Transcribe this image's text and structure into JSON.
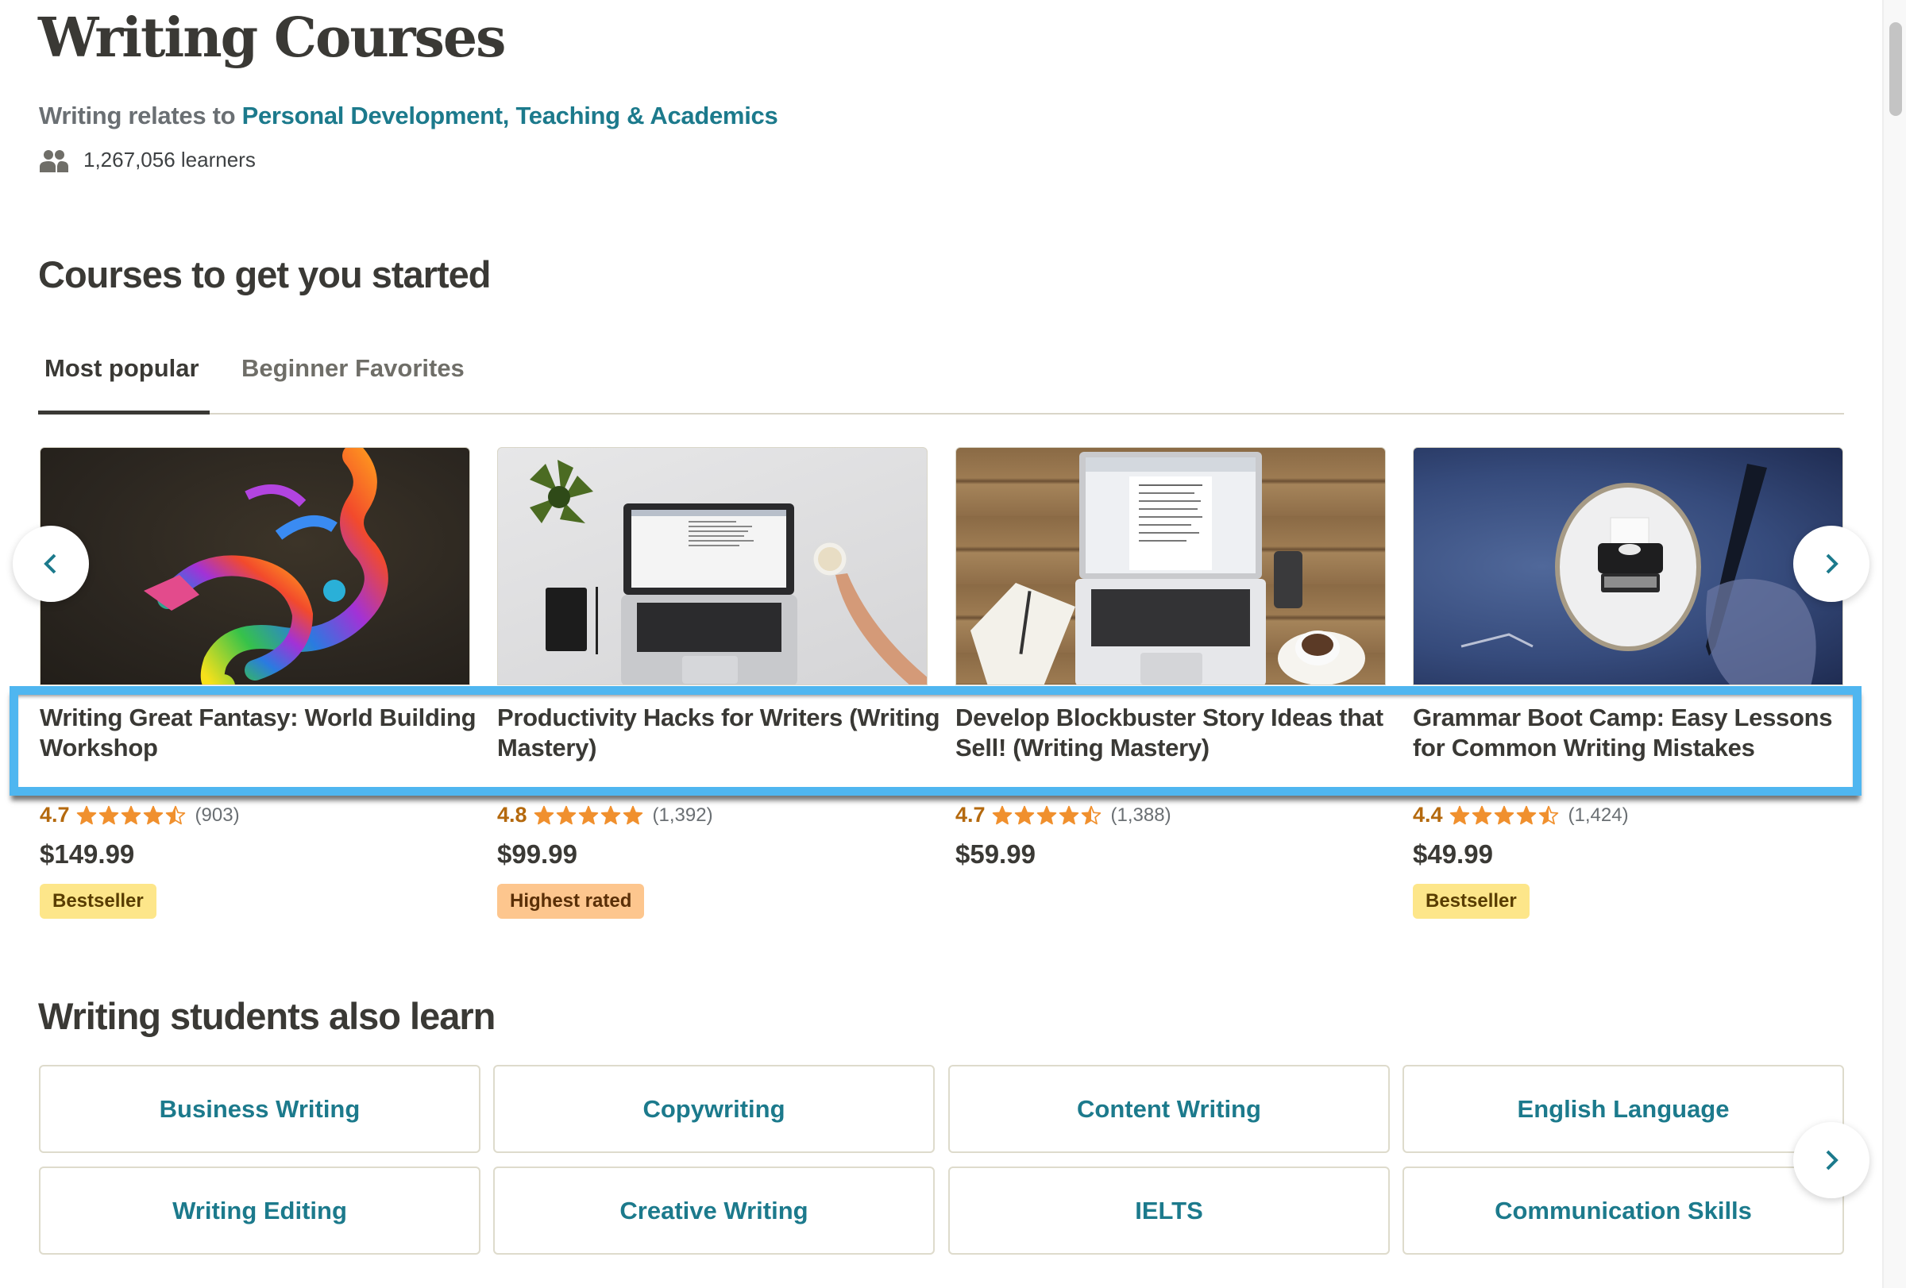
{
  "header": {
    "title": "Writing Courses",
    "relates_prefix": "Writing relates to",
    "relates_links": [
      "Personal Development",
      "Teaching & Academics"
    ],
    "relates_separator": ", ",
    "learners_icon": "people-icon",
    "learners": "1,267,056 learners"
  },
  "courses_section": {
    "title": "Courses to get you started",
    "tabs": [
      {
        "label": "Most popular",
        "active": true
      },
      {
        "label": "Beginner Favorites",
        "active": false
      }
    ],
    "prev_icon": "chevron-left-icon",
    "next_icon": "chevron-right-icon",
    "cards": [
      {
        "title": "Writing Great Fantasy: World Building Workshop",
        "image": "colorful-dragon-illustration",
        "rating": "4.7",
        "stars": 4.7,
        "reviews": "(903)",
        "price": "$149.99",
        "badge": "Bestseller"
      },
      {
        "title": "Productivity Hacks for Writers (Writing Mastery)",
        "image": "laptop-on-desk-with-plant-and-coffee",
        "rating": "4.8",
        "stars": 4.8,
        "reviews": "(1,392)",
        "price": "$99.99",
        "badge": "Highest rated"
      },
      {
        "title": "Develop Blockbuster Story Ideas that Sell! (Writing Mastery)",
        "image": "laptop-on-wooden-table-with-notebook",
        "rating": "4.7",
        "stars": 4.7,
        "reviews": "(1,388)",
        "price": "$59.99",
        "badge": ""
      },
      {
        "title": "Grammar Boot Camp: Easy Lessons for Common Writing Mistakes",
        "image": "typewriter-and-hand-writing",
        "rating": "4.4",
        "stars": 4.4,
        "reviews": "(1,424)",
        "price": "$49.99",
        "badge": "Bestseller"
      }
    ]
  },
  "also_learn": {
    "title": "Writing students also learn",
    "next_icon": "chevron-right-icon",
    "topics": [
      "Business Writing",
      "Copywriting",
      "Content Writing",
      "English Language",
      "Writing Editing",
      "Creative Writing",
      "IELTS",
      "Communication Skills"
    ]
  },
  "colors": {
    "link_teal": "#1c7a8c",
    "rating_orange": "#b4690e",
    "star_orange": "#f0902e",
    "bestseller_bg": "#fde68a",
    "highest_rated_bg": "#fdc68e",
    "highlight_blue": "#4fb6f0",
    "text_dark": "#3a3935"
  }
}
